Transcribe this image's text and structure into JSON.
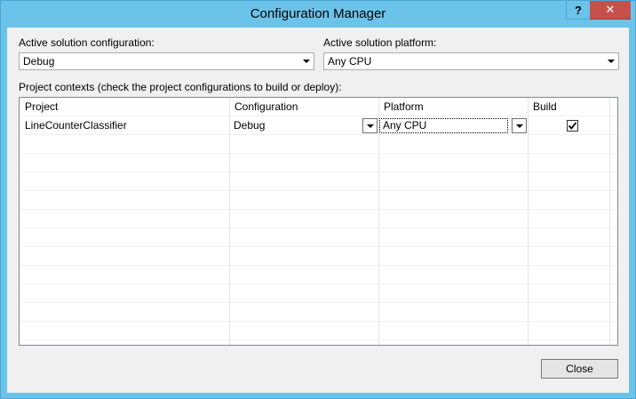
{
  "window": {
    "title": "Configuration Manager",
    "help_label": "?",
    "close_label": "✕"
  },
  "solution_config": {
    "label": "Active solution configuration:",
    "value": "Debug"
  },
  "solution_platform": {
    "label": "Active solution platform:",
    "value": "Any CPU"
  },
  "project_contexts": {
    "label": "Project contexts (check the project configurations to build or deploy):",
    "columns": [
      "Project",
      "Configuration",
      "Platform",
      "Build"
    ],
    "rows": [
      {
        "project": "LineCounterClassifier",
        "configuration": "Debug",
        "platform": "Any CPU",
        "build": true
      }
    ]
  },
  "buttons": {
    "close": "Close"
  },
  "colors": {
    "titlebar": "#6bc3ea",
    "close_button": "#c7504b",
    "dialog_background": "#f0f0f0"
  }
}
